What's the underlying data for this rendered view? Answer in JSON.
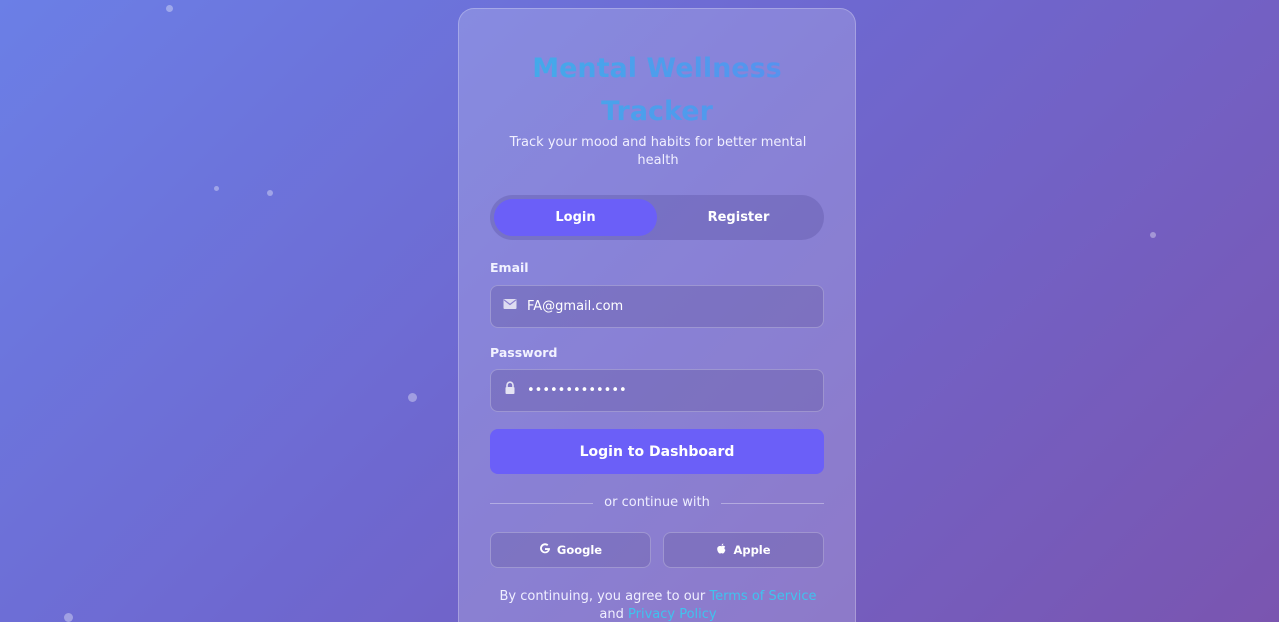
{
  "app": {
    "title_line1": "Mental Wellness",
    "title_line2": "Tracker",
    "subtitle": "Track your mood and habits for better mental health"
  },
  "tabs": [
    {
      "label": "Login",
      "active": true
    },
    {
      "label": "Register",
      "active": false
    }
  ],
  "form": {
    "email_label": "Email",
    "email_value": "FA@gmail.com",
    "email_icon": "mail-icon",
    "password_label": "Password",
    "password_value": "•••••••••••••",
    "password_icon": "lock-icon",
    "submit_label": "Login to Dashboard"
  },
  "divider_text": "or continue with",
  "social": [
    {
      "label": "Google",
      "icon": "google-icon"
    },
    {
      "label": "Apple",
      "icon": "apple-icon"
    }
  ],
  "terms": {
    "prefix": "By continuing, you agree to our",
    "tos_link": "Terms of Service",
    "and": "and",
    "privacy_link": "Privacy Policy"
  },
  "colors": {
    "accent": "#6b5ff8",
    "title_gradient_start": "#3fb0e8",
    "title_gradient_end": "#5b8cf0",
    "link": "#3fc3ee"
  }
}
